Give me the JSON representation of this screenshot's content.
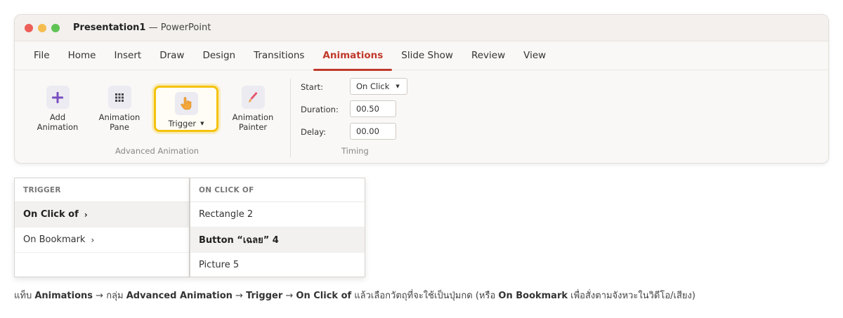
{
  "window": {
    "app_name": "Presentation1",
    "title_suffix": "— PowerPoint",
    "traffic_lights": [
      "#ed5f57",
      "#f5bd4f",
      "#5fc454"
    ]
  },
  "tabs": [
    "File",
    "Home",
    "Insert",
    "Draw",
    "Design",
    "Transitions",
    "Animations",
    "Slide Show",
    "Review",
    "View"
  ],
  "active_tab": "Animations",
  "ribbon": {
    "advanced": {
      "add_line1": "Add",
      "add_line2": "Animation",
      "pane_line1": "Animation",
      "pane_line2": "Pane",
      "trigger": "Trigger",
      "painter_line1": "Animation",
      "painter_line2": "Painter",
      "group_label": "Advanced Animation"
    },
    "timing": {
      "start_label": "Start:",
      "start_value": "On Click",
      "duration_label": "Duration:",
      "duration_value": "00.50",
      "delay_label": "Delay:",
      "delay_value": "00.00",
      "group_label": "Timing"
    }
  },
  "trigger_menu": {
    "header": "TRIGGER",
    "items": [
      "On Click of",
      "On Bookmark"
    ],
    "selected": "On Click of"
  },
  "submenu": {
    "header": "ON CLICK OF",
    "items": [
      "Rectangle 2",
      "Button “เฉลย” 4",
      "Picture 5"
    ],
    "selected": "Button “เฉลย” 4"
  },
  "caption": {
    "p1": "แท็บ ",
    "b1": "Animations",
    "p2": " → กลุ่ม ",
    "b2": "Advanced Animation",
    "p3": " → ",
    "b3": "Trigger",
    "p4": " → ",
    "b4": "On Click of",
    "p5": " แล้วเลือกวัตถุที่จะใช้เป็นปุ่มกด  (หรือ ",
    "b5": "On Bookmark",
    "p6": " เพื่อสั่งตามจังหวะในวิดีโอ/เสียง)"
  },
  "colors": {
    "accent": "#c0392b",
    "highlight": "#f4c20d"
  },
  "icons": [
    "plus-icon",
    "grid-icon",
    "hand-pointer-icon",
    "paintbrush-icon",
    "caret-down-icon",
    "chevron-right-icon"
  ]
}
